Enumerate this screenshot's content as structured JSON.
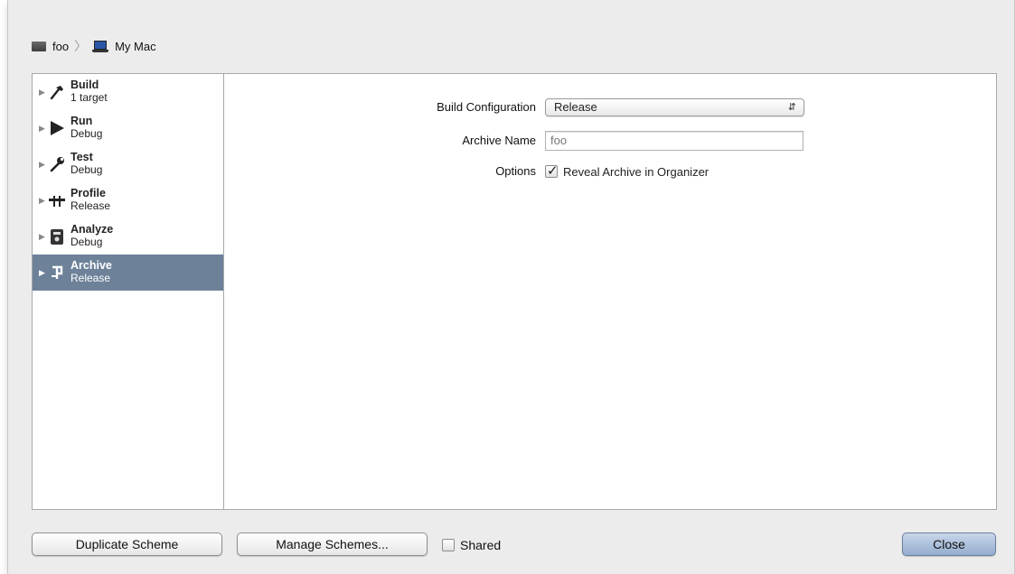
{
  "breadcrumb": {
    "project": "foo",
    "destination": "My Mac"
  },
  "actions": [
    {
      "name": "Build",
      "detail": "1 target",
      "icon": "hammer-icon"
    },
    {
      "name": "Run",
      "detail": "Debug",
      "icon": "play-icon"
    },
    {
      "name": "Test",
      "detail": "Debug",
      "icon": "wrench-icon"
    },
    {
      "name": "Profile",
      "detail": "Release",
      "icon": "instruments-icon"
    },
    {
      "name": "Analyze",
      "detail": "Debug",
      "icon": "analyze-icon"
    },
    {
      "name": "Archive",
      "detail": "Release",
      "icon": "archive-icon",
      "selected": true
    }
  ],
  "form": {
    "build_config_label": "Build Configuration",
    "build_config_value": "Release",
    "archive_name_label": "Archive Name",
    "archive_name_value": "foo",
    "options_label": "Options",
    "reveal_label": "Reveal Archive in Organizer",
    "reveal_checked": true
  },
  "footer": {
    "duplicate_label": "Duplicate Scheme",
    "manage_label": "Manage Schemes...",
    "shared_label": "Shared",
    "shared_checked": false,
    "close_label": "Close"
  },
  "colors": {
    "selection": "#6d8299",
    "sheet_bg": "#ececec",
    "primary_button": "#94acce"
  }
}
